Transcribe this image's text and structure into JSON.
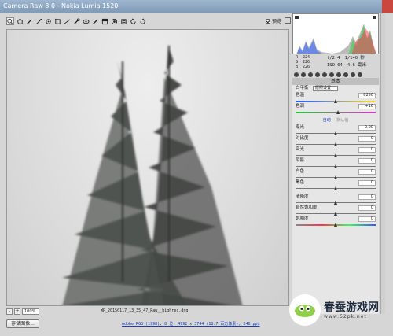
{
  "window": {
    "title": "Camera Raw 8.0 -  Nokia Lumia 1520"
  },
  "toolbar": {
    "tools": [
      "zoom-icon",
      "hand-icon",
      "white-balance-icon",
      "color-sampler-icon",
      "target-adjust-icon",
      "crop-icon",
      "straighten-icon",
      "spot-removal-icon",
      "red-eye-icon",
      "adjustment-brush-icon",
      "graduated-filter-icon",
      "radial-filter-icon",
      "preferences-icon",
      "rotate-ccw-icon",
      "rotate-cw-icon"
    ],
    "preview_label": "预览"
  },
  "bottom": {
    "zoom_minus": "-",
    "zoom_plus": "+",
    "zoom_value": "100%",
    "filename": "WP_20150117_13_35_47_Raw__highres.dng",
    "save_label": "存储图像...",
    "workflow": "Adobe RGB (1998); 8 位; 4992 x 3744 (18.7 百万像素); 240 ppi"
  },
  "info": {
    "r": "R:  224",
    "g": "G:  226",
    "b": "B:  226",
    "aperture": "f/2.4",
    "shutter": "1/140 秒",
    "iso": "ISO 64",
    "focal": "4.6 毫米"
  },
  "panel": {
    "title": "基本",
    "wb_label": "白平衡",
    "wb_value": "原照设置",
    "temp_label": "色温",
    "temp_value": "6250",
    "tint_label": "色调",
    "tint_value": "+16",
    "auto_label": "自动",
    "default_label": "默认值",
    "sliders": [
      {
        "label": "曝光",
        "value": "0.00",
        "pos": 0.5
      },
      {
        "label": "对比度",
        "value": "0",
        "pos": 0.5
      },
      {
        "label": "高光",
        "value": "0",
        "pos": 0.5
      },
      {
        "label": "阴影",
        "value": "0",
        "pos": 0.5
      },
      {
        "label": "白色",
        "value": "0",
        "pos": 0.5
      },
      {
        "label": "黑色",
        "value": "0",
        "pos": 0.5
      }
    ],
    "sliders2": [
      {
        "label": "清晰度",
        "value": "0",
        "pos": 0.5
      },
      {
        "label": "自然饱和度",
        "value": "0",
        "pos": 0.5
      },
      {
        "label": "饱和度",
        "value": "0",
        "pos": 0.5
      }
    ]
  },
  "watermark": {
    "name": "春蚕游戏网",
    "url": "www.52pk.net"
  }
}
